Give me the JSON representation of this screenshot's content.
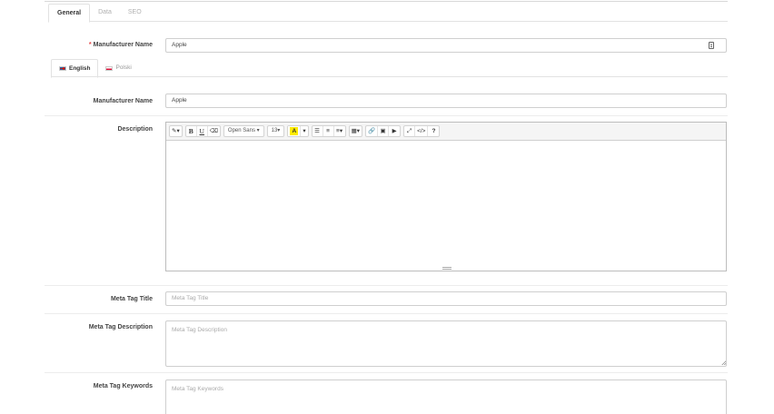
{
  "tabs": [
    {
      "label": "General",
      "active": true
    },
    {
      "label": "Data",
      "active": false
    },
    {
      "label": "SEO",
      "active": false
    }
  ],
  "manufacturer": {
    "required_mark": "*",
    "label": "Manufacturer Name",
    "value": "Apple",
    "icon": "document-icon"
  },
  "languages": [
    {
      "label": "English",
      "flag": "flag-uk-icon",
      "active": true
    },
    {
      "label": "Polski",
      "flag": "flag-pl-icon",
      "active": false
    }
  ],
  "lang_form": {
    "name_label": "Manufacturer Name",
    "name_value": "Apple",
    "description_label": "Description",
    "toolbar": {
      "style": "✎▾",
      "bold": "B",
      "underline": "U",
      "clear": "⌫",
      "font_family": "Open Sans ▾",
      "font_size": "13▾",
      "color_letter": "A",
      "color_caret": "▾",
      "ul": "☰",
      "ol": "≡",
      "align": "≡▾",
      "table": "▦▾",
      "link": "🔗",
      "image": "▣",
      "video": "▶",
      "fullscreen": "⤢",
      "code": "</>",
      "help": "?"
    },
    "meta_title_label": "Meta Tag Title",
    "meta_title_placeholder": "Meta Tag Title",
    "meta_desc_label": "Meta Tag Description",
    "meta_desc_placeholder": "Meta Tag Description",
    "meta_keywords_label": "Meta Tag Keywords",
    "meta_keywords_placeholder": "Meta Tag Keywords"
  }
}
